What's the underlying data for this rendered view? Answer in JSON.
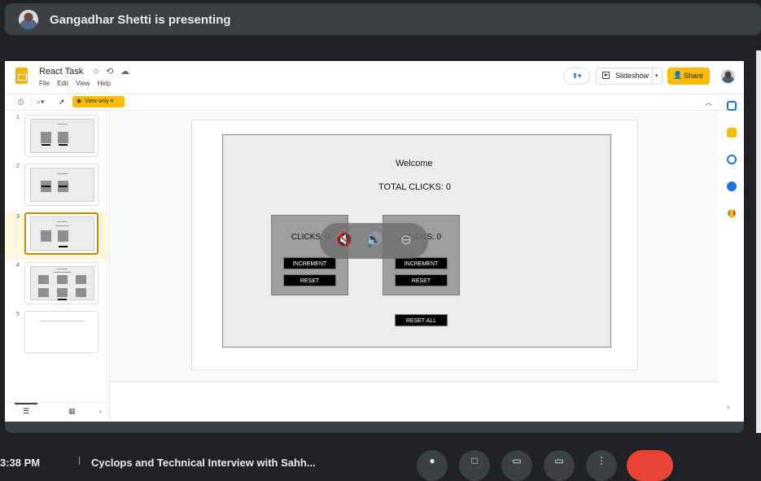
{
  "presenter": {
    "text": "Gangadhar Shetti is presenting"
  },
  "slides_app": {
    "doc_title": "React Task",
    "menu": [
      "File",
      "Edit",
      "View",
      "Help"
    ],
    "slideshow_label": "Slideshow",
    "share_label": "Share",
    "view_only_label": "View only",
    "slide_numbers": [
      "1",
      "2",
      "3",
      "4",
      "5"
    ],
    "active_slide": 3
  },
  "slide": {
    "welcome": "Welcome",
    "total_clicks": "TOTAL CLICKS: 0",
    "card_left": {
      "clicks": "CLICKS: 0",
      "increment": "INCREMENT",
      "reset": "RESET"
    },
    "card_right": {
      "clicks": "CLICKS: 0",
      "increment": "INCREMENT",
      "reset": "RESET"
    },
    "reset_all": "RESET ALL"
  },
  "meeting": {
    "time": "3:38 PM",
    "name": "Cyclops and Technical Interview with Sahh..."
  },
  "colors": {
    "share_yellow": "#fbbc04",
    "end_call_red": "#ea4335",
    "meet_bg": "#202124"
  },
  "icons": [
    "star-icon",
    "move-to-folder-icon",
    "cloud-status-icon",
    "present-icon",
    "print-icon",
    "zoom-icon",
    "select-cursor-icon",
    "eye-icon",
    "mute-icon",
    "volume-icon",
    "remove-icon",
    "calendar-icon",
    "keep-icon",
    "tasks-icon",
    "contacts-icon",
    "maps-icon"
  ]
}
